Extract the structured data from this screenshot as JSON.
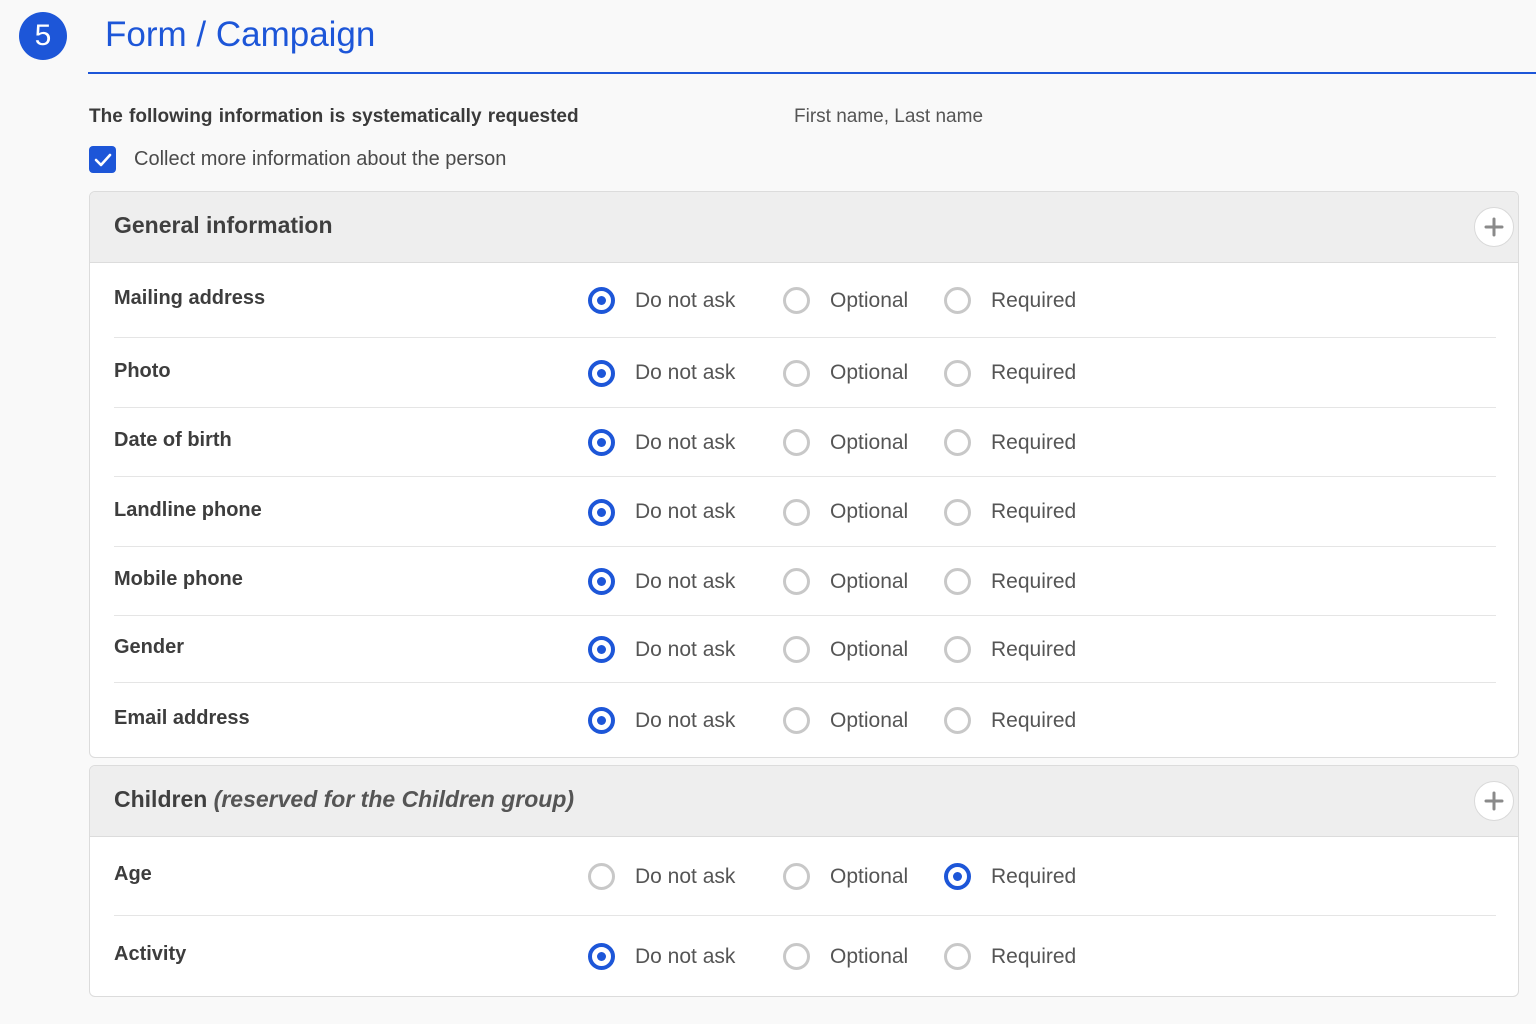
{
  "step": {
    "number": "5",
    "title": "Form / Campaign"
  },
  "systematic": {
    "label": "The following information is systematically requested",
    "value": "First name, Last name"
  },
  "collect_more": {
    "label": "Collect more information about the person",
    "checked": true
  },
  "option_labels": [
    "Do not ask",
    "Optional",
    "Required"
  ],
  "sections": [
    {
      "title": "General information",
      "subtitle": "",
      "rows": [
        {
          "label": "Mailing address",
          "selected": 0
        },
        {
          "label": "Photo",
          "selected": 0
        },
        {
          "label": "Date of birth",
          "selected": 0
        },
        {
          "label": "Landline phone",
          "selected": 0
        },
        {
          "label": "Mobile phone",
          "selected": 0
        },
        {
          "label": "Gender",
          "selected": 0
        },
        {
          "label": "Email address",
          "selected": 0
        }
      ]
    },
    {
      "title": "Children",
      "subtitle": "(reserved for the Children group)",
      "rows": [
        {
          "label": "Age",
          "selected": 2
        },
        {
          "label": "Activity",
          "selected": 0
        }
      ]
    }
  ],
  "colors": {
    "accent": "#1d56d8",
    "radio_off": "#c8c8c8",
    "header_bg": "#eeeeee"
  },
  "icons": {
    "checkbox": "checkmark-icon",
    "expand": "plus-icon"
  }
}
